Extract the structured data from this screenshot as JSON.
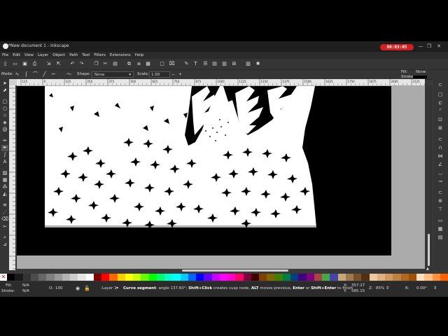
{
  "window": {
    "title": "*New document 1 - Inkscape",
    "timer": "00:03:05",
    "minimize": "—",
    "restore": "❐",
    "close": "✕"
  },
  "menu": [
    "File",
    "Edit",
    "View",
    "Layer",
    "Object",
    "Path",
    "Text",
    "Filters",
    "Extensions",
    "Help"
  ],
  "tool_controls": {
    "mode_label": "Mode:",
    "shape_label": "Shape:",
    "shape_value": "None",
    "scale_label": "Scale:",
    "scale_value": "1.00"
  },
  "ruler_ticks": [
    "125",
    "0",
    "125",
    "250",
    "375",
    "500",
    "625",
    "750",
    "875",
    "1000",
    "1125",
    "1250",
    "1375",
    "1500",
    "1625",
    "1750",
    "1875",
    "2000",
    "2125"
  ],
  "fill_stroke": {
    "fill_label": "Fill:",
    "fill_value": "None",
    "stroke_label": "Stroke:"
  },
  "status": {
    "fill_label": "Fill:",
    "fill_value": "N/A",
    "stroke_label": "Stroke:",
    "stroke_value": "N/A",
    "opacity_label": "O:",
    "opacity_value": "100",
    "layer": "-Layer 1",
    "message_bold": "Curve segment",
    "message_rest": ": angle 137.60°; ",
    "hint1_bold": "Shift+Click",
    "hint1_rest": " creates cusp node, ",
    "hint2_bold": "ALT",
    "hint2_rest": " moves previous, ",
    "hint3_bold": "Enter",
    "hint3_mid": " or ",
    "hint4_bold": "Shift+Enter",
    "hint4_rest": " to finish",
    "x_label": "X:",
    "x_value": "357.27",
    "y_label": "Y:",
    "y_value": "585.15",
    "zoom_label": "Z:",
    "zoom_value": "85%",
    "rotation_label": "R:",
    "rotation_value": "0.00°"
  },
  "colors": {
    "accent_timer": "#d51f1f",
    "canvas_bg": "#ababab",
    "page_bg": "#000000"
  },
  "palette": [
    "#000000",
    "#1a1a1a",
    "#333333",
    "#4d4d4d",
    "#666666",
    "#808080",
    "#999999",
    "#b3b3b3",
    "#cccccc",
    "#e6e6e6",
    "#ffffff",
    "#800000",
    "#ff0000",
    "#ff6600",
    "#ffcc00",
    "#ffff00",
    "#ccff00",
    "#66ff00",
    "#00ff00",
    "#00ff66",
    "#00ffcc",
    "#00ffff",
    "#00ccff",
    "#0066ff",
    "#0000ff",
    "#6600ff",
    "#cc00ff",
    "#ff00ff",
    "#ff00cc",
    "#ff0066",
    "#800040",
    "#400000",
    "#804000",
    "#806600",
    "#408000",
    "#008040",
    "#004080",
    "#400080",
    "#800080",
    "#aa4444",
    "#44aa44",
    "#4444aa",
    "#c8a878",
    "#a07850",
    "#785028",
    "#503010",
    "#f0c8a0",
    "#e0b080",
    "#d09860",
    "#c08040",
    "#b06820",
    "#a05000",
    "#ffe0c0",
    "#ffc080",
    "#ff9040",
    "#ff6000"
  ]
}
